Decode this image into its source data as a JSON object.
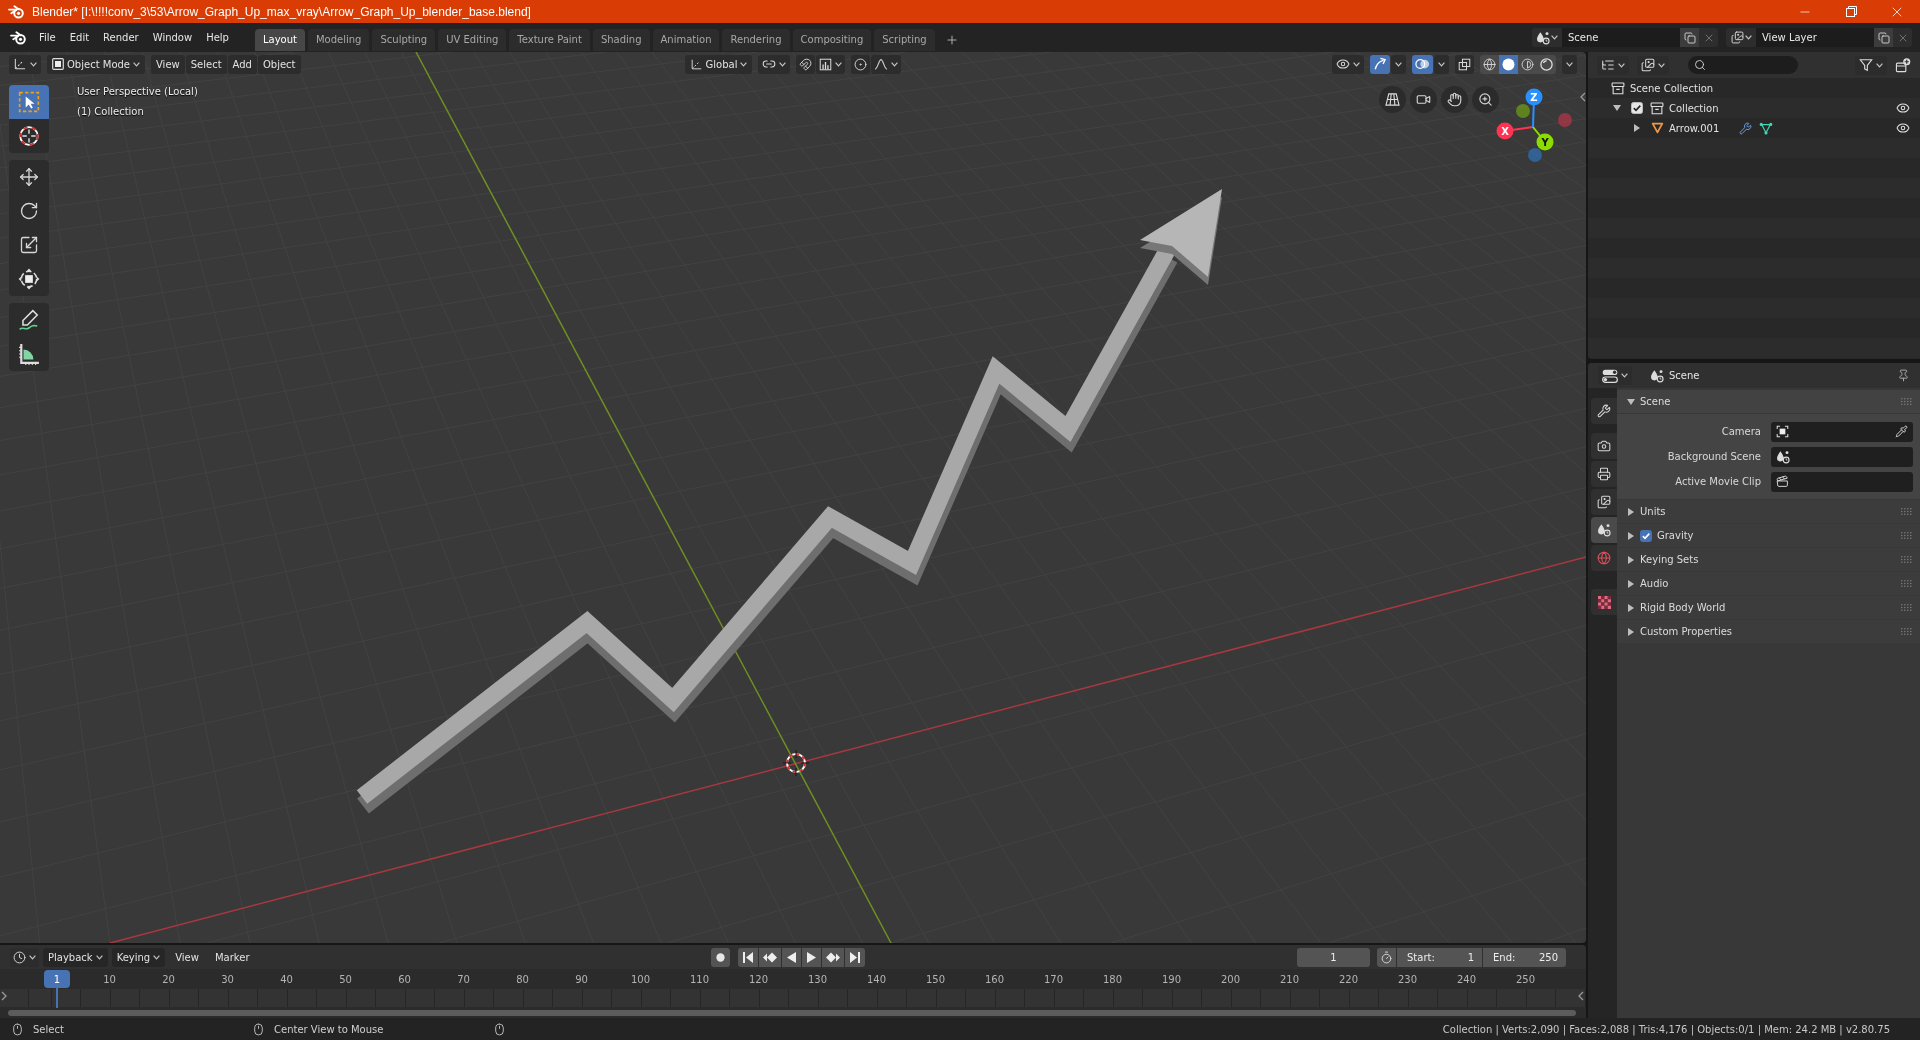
{
  "window": {
    "title": "Blender* [I:\\!!!!conv_3\\53\\Arrow_Graph_Up_max_vray\\Arrow_Graph_Up_blender_base.blend]"
  },
  "menu_bar": [
    "File",
    "Edit",
    "Render",
    "Window",
    "Help"
  ],
  "workspace_tabs": [
    {
      "label": "Layout",
      "selected": true
    },
    {
      "label": "Modeling",
      "selected": false
    },
    {
      "label": "Sculpting",
      "selected": false
    },
    {
      "label": "UV Editing",
      "selected": false
    },
    {
      "label": "Texture Paint",
      "selected": false
    },
    {
      "label": "Shading",
      "selected": false
    },
    {
      "label": "Animation",
      "selected": false
    },
    {
      "label": "Rendering",
      "selected": false
    },
    {
      "label": "Compositing",
      "selected": false
    },
    {
      "label": "Scripting",
      "selected": false
    }
  ],
  "scene_selector": {
    "scene": "Scene",
    "view_layer": "View Layer"
  },
  "viewport": {
    "mode": "Object Mode",
    "menus": [
      "View",
      "Select",
      "Add",
      "Object"
    ],
    "orientation": "Global",
    "show_gizmos": true,
    "show_overlays": true,
    "shading_modes": [
      {
        "kind": "wireframe",
        "selected": false
      },
      {
        "kind": "solid",
        "selected": true
      },
      {
        "kind": "material",
        "selected": false
      },
      {
        "kind": "rendered",
        "selected": false
      }
    ],
    "tool_groups": [
      [
        {
          "kind": "select_box",
          "selected": true
        },
        {
          "kind": "cursor",
          "selected": false
        }
      ],
      [
        {
          "kind": "move",
          "selected": false
        },
        {
          "kind": "rotate",
          "selected": false
        },
        {
          "kind": "scale",
          "selected": false
        },
        {
          "kind": "transform",
          "selected": false
        }
      ],
      [
        {
          "kind": "annotate",
          "selected": false
        },
        {
          "kind": "measure",
          "selected": false
        }
      ]
    ],
    "info_lines": [
      "User Perspective (Local)",
      "(1) Collection"
    ],
    "gizmo_axes": [
      {
        "label": "X",
        "color": "#ff3352"
      },
      {
        "label": "Y",
        "color": "#8bdc00"
      },
      {
        "label": "Z",
        "color": "#2890ff"
      }
    ]
  },
  "outliner": {
    "rows": [
      {
        "label": "Scene Collection",
        "kind": "scene_collection",
        "children": [
          {
            "label": "Collection",
            "kind": "collection",
            "expanded": true,
            "checked": true,
            "visible": true,
            "children": [
              {
                "label": "Arrow.001",
                "kind": "mesh_object",
                "expanded": false,
                "visible": true
              }
            ]
          }
        ]
      }
    ]
  },
  "properties": {
    "context": "Scene",
    "tab_groups": [
      [
        {
          "kind": "tool",
          "selected": false
        }
      ],
      [
        {
          "kind": "render",
          "selected": false
        },
        {
          "kind": "output",
          "selected": false
        },
        {
          "kind": "view_layer",
          "selected": false
        },
        {
          "kind": "scene",
          "selected": true
        },
        {
          "kind": "world",
          "selected": false
        }
      ],
      [
        {
          "kind": "texture",
          "selected": false
        }
      ]
    ],
    "panels": [
      {
        "title": "Scene",
        "expanded": true,
        "fields": [
          {
            "label": "Camera",
            "kind": "camera"
          },
          {
            "label": "Background Scene",
            "kind": "scene"
          },
          {
            "label": "Active Movie Clip",
            "kind": "clip"
          }
        ]
      },
      {
        "title": "Units",
        "expanded": false
      },
      {
        "title": "Gravity",
        "expanded": false,
        "checked": true
      },
      {
        "title": "Keying Sets",
        "expanded": false
      },
      {
        "title": "Audio",
        "expanded": false
      },
      {
        "title": "Rigid Body World",
        "expanded": false
      },
      {
        "title": "Custom Properties",
        "expanded": false
      }
    ]
  },
  "timeline": {
    "menus": [
      {
        "label": "Playback",
        "dropdown": true
      },
      {
        "label": "Keying",
        "dropdown": true
      },
      {
        "label": "View",
        "dropdown": false
      },
      {
        "label": "Marker",
        "dropdown": false
      }
    ],
    "current_frame": "1",
    "start_label": "Start:",
    "start": "1",
    "end_label": "End:",
    "end": "250",
    "ruler": [
      {
        "label": "1",
        "selected": true
      },
      {
        "label": "10",
        "selected": false
      },
      {
        "label": "20",
        "selected": false
      },
      {
        "label": "30",
        "selected": false
      },
      {
        "label": "40",
        "selected": false
      },
      {
        "label": "50",
        "selected": false
      },
      {
        "label": "60",
        "selected": false
      },
      {
        "label": "70",
        "selected": false
      },
      {
        "label": "80",
        "selected": false
      },
      {
        "label": "90",
        "selected": false
      },
      {
        "label": "100",
        "selected": false
      },
      {
        "label": "110",
        "selected": false
      },
      {
        "label": "120",
        "selected": false
      },
      {
        "label": "130",
        "selected": false
      },
      {
        "label": "140",
        "selected": false
      },
      {
        "label": "150",
        "selected": false
      },
      {
        "label": "160",
        "selected": false
      },
      {
        "label": "170",
        "selected": false
      },
      {
        "label": "180",
        "selected": false
      },
      {
        "label": "190",
        "selected": false
      },
      {
        "label": "200",
        "selected": false
      },
      {
        "label": "210",
        "selected": false
      },
      {
        "label": "220",
        "selected": false
      },
      {
        "label": "230",
        "selected": false
      },
      {
        "label": "240",
        "selected": false
      },
      {
        "label": "250",
        "selected": false
      }
    ]
  },
  "status_bar": {
    "hints": [
      "Select",
      "Center View to Mouse"
    ],
    "info": "Collection | Verts:2,090 | Faces:2,088 | Tris:4,176 | Objects:0/1 | Mem: 24.2 MB | v2.80.75"
  }
}
